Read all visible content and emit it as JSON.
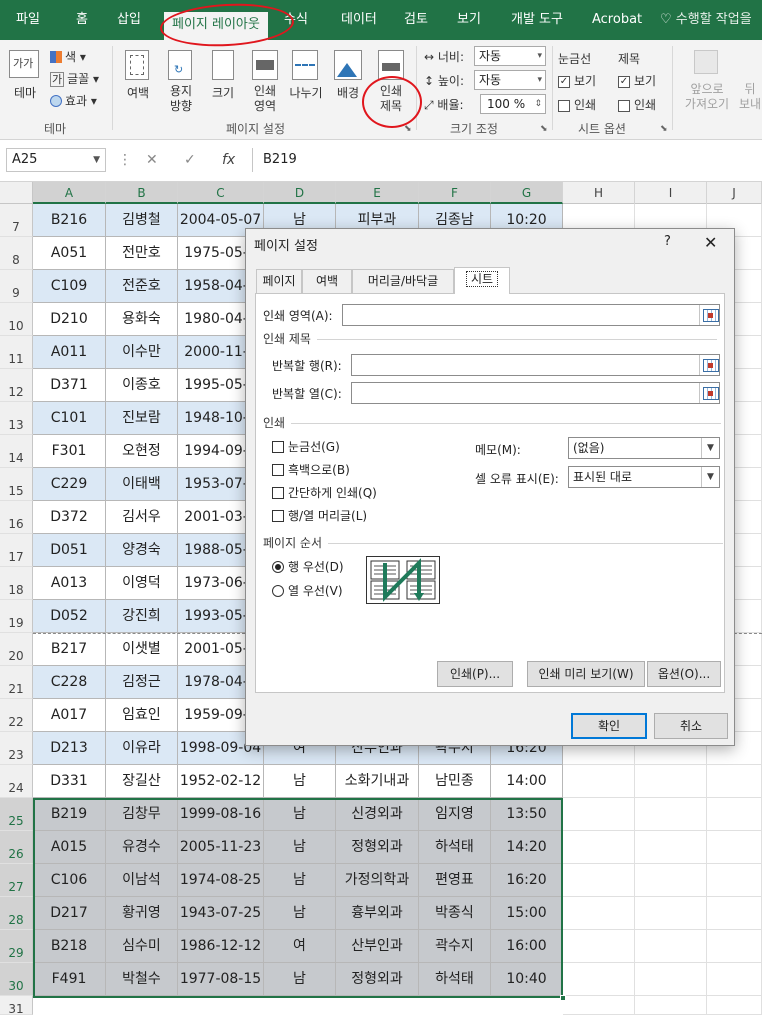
{
  "menu": {
    "tabs": [
      "파일",
      "홈",
      "삽입",
      "페이지 레이아웃",
      "수식",
      "데이터",
      "검토",
      "보기",
      "개발 도구",
      "Acrobat"
    ],
    "active_index": 3,
    "tell_me": "수행할 작업을"
  },
  "ribbon": {
    "theme": {
      "label": "테마",
      "colors": "색",
      "fonts": "글꼴",
      "effects": "효과",
      "group": "테마"
    },
    "page_setup": {
      "margins": "여백",
      "orientation": "용지\n방향",
      "size": "크기",
      "print_area": "인쇄\n영역",
      "breaks": "나누기",
      "background": "배경",
      "print_titles": "인쇄\n제목",
      "group": "페이지 설정"
    },
    "scale": {
      "width_label": "너비:",
      "width_value": "자동",
      "height_label": "높이:",
      "height_value": "자동",
      "scale_label": "배율:",
      "scale_value": "100 %",
      "group": "크기 조정"
    },
    "sheet_options": {
      "gridlines": "눈금선",
      "headings": "제목",
      "view": "보기",
      "print": "인쇄",
      "group": "시트 옵션"
    },
    "arrange": {
      "bring_forward": "앞으로\n가져오기",
      "send_backward": "뒤\n보내"
    }
  },
  "formula_bar": {
    "name_box": "A25",
    "content": "B219"
  },
  "grid": {
    "columns": [
      "A",
      "B",
      "C",
      "D",
      "E",
      "F",
      "G",
      "H",
      "I",
      "J"
    ],
    "rows": [
      {
        "num": "7",
        "cells": [
          "B216",
          "김병철",
          "2004-05-07",
          "남",
          "피부과",
          "김종남",
          "10:20"
        ]
      },
      {
        "num": "8",
        "cells": [
          "A051",
          "전만호",
          "1975-05-0",
          "",
          "",
          "",
          ""
        ]
      },
      {
        "num": "9",
        "cells": [
          "C109",
          "전준호",
          "1958-04-0",
          "",
          "",
          "",
          ""
        ]
      },
      {
        "num": "10",
        "cells": [
          "D210",
          "용화숙",
          "1980-04-0",
          "",
          "",
          "",
          ""
        ]
      },
      {
        "num": "11",
        "cells": [
          "A011",
          "이수만",
          "2000-11-0",
          "",
          "",
          "",
          ""
        ]
      },
      {
        "num": "12",
        "cells": [
          "D371",
          "이종호",
          "1995-05-1",
          "",
          "",
          "",
          ""
        ]
      },
      {
        "num": "13",
        "cells": [
          "C101",
          "진보람",
          "1948-10-0",
          "",
          "",
          "",
          ""
        ]
      },
      {
        "num": "14",
        "cells": [
          "F301",
          "오현정",
          "1994-09-3",
          "",
          "",
          "",
          ""
        ]
      },
      {
        "num": "15",
        "cells": [
          "C229",
          "이태백",
          "1953-07-0",
          "",
          "",
          "",
          ""
        ]
      },
      {
        "num": "16",
        "cells": [
          "D372",
          "김서우",
          "2001-03-1",
          "",
          "",
          "",
          ""
        ]
      },
      {
        "num": "17",
        "cells": [
          "D051",
          "양경숙",
          "1988-05-0",
          "",
          "",
          "",
          ""
        ]
      },
      {
        "num": "18",
        "cells": [
          "A013",
          "이영덕",
          "1973-06-0",
          "",
          "",
          "",
          ""
        ]
      },
      {
        "num": "19",
        "cells": [
          "D052",
          "강진희",
          "1993-05-0",
          "",
          "",
          "",
          ""
        ]
      },
      {
        "num": "20",
        "cells": [
          "B217",
          "이샛별",
          "2001-05-0",
          "",
          "",
          "",
          ""
        ]
      },
      {
        "num": "21",
        "cells": [
          "C228",
          "김정근",
          "1978-04-0",
          "",
          "",
          "",
          ""
        ]
      },
      {
        "num": "22",
        "cells": [
          "A017",
          "임효인",
          "1959-09-0",
          "",
          "",
          "",
          ""
        ]
      },
      {
        "num": "23",
        "cells": [
          "D213",
          "이유라",
          "1998-09-04",
          "여",
          "산부인과",
          "곽수지",
          "16:20"
        ]
      },
      {
        "num": "24",
        "cells": [
          "D331",
          "장길산",
          "1952-02-12",
          "남",
          "소화기내과",
          "남민종",
          "14:00"
        ]
      },
      {
        "num": "25",
        "cells": [
          "B219",
          "김창무",
          "1999-08-16",
          "남",
          "신경외과",
          "임지영",
          "13:50"
        ]
      },
      {
        "num": "26",
        "cells": [
          "A015",
          "유경수",
          "2005-11-23",
          "남",
          "정형외과",
          "하석태",
          "14:20"
        ]
      },
      {
        "num": "27",
        "cells": [
          "C106",
          "이남석",
          "1974-08-25",
          "남",
          "가정의학과",
          "편영표",
          "16:20"
        ]
      },
      {
        "num": "28",
        "cells": [
          "D217",
          "황귀영",
          "1943-07-25",
          "남",
          "흉부외과",
          "박종식",
          "15:00"
        ]
      },
      {
        "num": "29",
        "cells": [
          "B218",
          "심수미",
          "1986-12-12",
          "여",
          "산부인과",
          "곽수지",
          "16:00"
        ]
      },
      {
        "num": "30",
        "cells": [
          "F491",
          "박철수",
          "1977-08-15",
          "남",
          "정형외과",
          "하석태",
          "10:40"
        ]
      },
      {
        "num": "31",
        "cells": [
          "",
          "",
          "",
          "",
          "",
          "",
          ""
        ]
      }
    ]
  },
  "dialog": {
    "title": "페이지 설정",
    "help": "?",
    "close": "✕",
    "tabs": [
      "페이지",
      "여백",
      "머리글/바닥글",
      "시트"
    ],
    "active_tab": 3,
    "print_area_label": "인쇄 영역(A):",
    "print_titles_section": "인쇄 제목",
    "repeat_rows_label": "반복할 행(R):",
    "repeat_cols_label": "반복할 열(C):",
    "print_section": "인쇄",
    "checks": [
      "눈금선(G)",
      "흑백으로(B)",
      "간단하게 인쇄(Q)",
      "행/열 머리글(L)"
    ],
    "comments_label": "메모(M):",
    "comments_value": "(없음)",
    "errors_label": "셀 오류 표시(E):",
    "errors_value": "표시된 대로",
    "page_order_section": "페이지 순서",
    "order_options": [
      "행 우선(D)",
      "열 우선(V)"
    ],
    "order_selected": 0,
    "buttons": {
      "print": "인쇄(P)...",
      "preview": "인쇄 미리 보기(W)",
      "options": "옵션(O)...",
      "ok": "확인",
      "cancel": "취소"
    }
  },
  "colors": {
    "excel_green": "#217346",
    "annotation_red": "#e0161d",
    "row_blue": "#dbe8f5",
    "selected_gray": "#c6c9cd"
  }
}
